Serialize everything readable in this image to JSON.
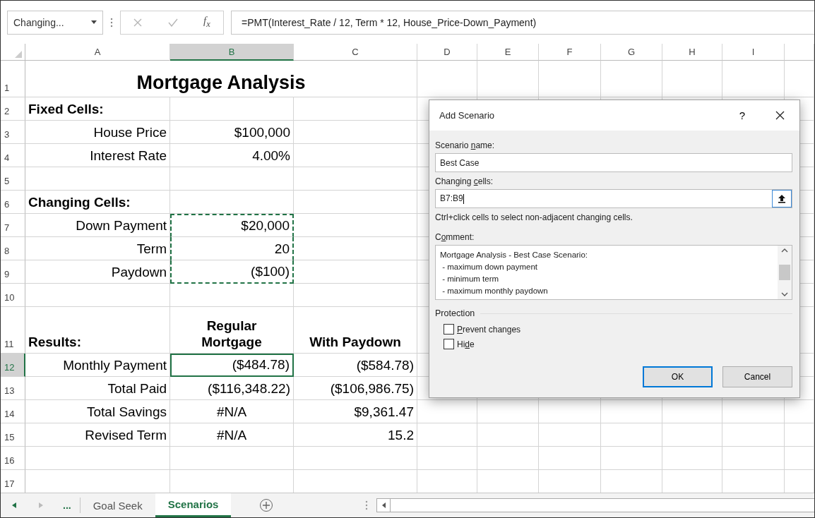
{
  "formula_bar": {
    "name_box": "Changing...",
    "fx_label": "f$_{x}$",
    "formula": "=PMT(Interest_Rate / 12, Term * 12, House_Price-Down_Payment)"
  },
  "columns": [
    {
      "label": "A",
      "selected": false
    },
    {
      "label": "B",
      "selected": true
    },
    {
      "label": "C",
      "selected": false
    },
    {
      "label": "D",
      "selected": false
    },
    {
      "label": "E",
      "selected": false
    },
    {
      "label": "F",
      "selected": false
    },
    {
      "label": "G",
      "selected": false
    },
    {
      "label": "H",
      "selected": false
    },
    {
      "label": "I",
      "selected": false
    }
  ],
  "rows": [
    {
      "number": "1",
      "selected": false,
      "title": "Mortgage Analysis"
    },
    {
      "number": "2",
      "selected": false,
      "cells": [
        {
          "text": "Fixed Cells:",
          "kind": "heading",
          "selected": false,
          "marked": false
        },
        null,
        null
      ]
    },
    {
      "number": "3",
      "selected": false,
      "cells": [
        {
          "text": "House Price",
          "kind": "label",
          "selected": false,
          "marked": false
        },
        {
          "text": "$100,000",
          "kind": "value",
          "selected": false,
          "marked": false
        },
        null
      ]
    },
    {
      "number": "4",
      "selected": false,
      "cells": [
        {
          "text": "Interest Rate",
          "kind": "label",
          "selected": false,
          "marked": false
        },
        {
          "text": "4.00%",
          "kind": "value",
          "selected": false,
          "marked": false
        },
        null
      ]
    },
    {
      "number": "5",
      "selected": false,
      "cells": [
        null,
        null,
        null
      ]
    },
    {
      "number": "6",
      "selected": false,
      "cells": [
        {
          "text": "Changing Cells:",
          "kind": "heading",
          "selected": false,
          "marked": false
        },
        null,
        null
      ]
    },
    {
      "number": "7",
      "selected": false,
      "cells": [
        {
          "text": "Down Payment",
          "kind": "label",
          "selected": false,
          "marked": false
        },
        {
          "text": "$20,000",
          "kind": "value",
          "selected": false,
          "marked": true
        },
        null
      ]
    },
    {
      "number": "8",
      "selected": false,
      "cells": [
        {
          "text": "Term",
          "kind": "label",
          "selected": false,
          "marked": false
        },
        {
          "text": "20",
          "kind": "value",
          "selected": false,
          "marked": true
        },
        null
      ]
    },
    {
      "number": "9",
      "selected": false,
      "cells": [
        {
          "text": "Paydown",
          "kind": "label",
          "selected": false,
          "marked": false
        },
        {
          "text": "($100)",
          "kind": "value",
          "selected": false,
          "marked": true
        },
        null
      ]
    },
    {
      "number": "10",
      "selected": false,
      "cells": [
        null,
        null,
        null
      ]
    },
    {
      "number": "11",
      "selected": false,
      "cells": [
        {
          "text": "Results:",
          "kind": "heading",
          "selected": false,
          "marked": false
        },
        {
          "lines": [
            "Regular",
            "Mortgage"
          ],
          "kind": "column-heading",
          "selected": false,
          "marked": false
        },
        {
          "lines": [
            "With Paydown"
          ],
          "kind": "column-heading",
          "selected": false,
          "marked": false
        }
      ]
    },
    {
      "number": "12",
      "selected": true,
      "cells": [
        {
          "text": "Monthly Payment",
          "kind": "label",
          "selected": false,
          "marked": false
        },
        {
          "text": "($484.78)",
          "kind": "value",
          "selected": true,
          "marked": false
        },
        {
          "text": "($584.78)",
          "kind": "value",
          "selected": false,
          "marked": false
        }
      ]
    },
    {
      "number": "13",
      "selected": false,
      "cells": [
        {
          "text": "Total Paid",
          "kind": "label",
          "selected": false,
          "marked": false
        },
        {
          "text": "($116,348.22)",
          "kind": "value",
          "selected": false,
          "marked": false
        },
        {
          "text": "($106,986.75)",
          "kind": "value",
          "selected": false,
          "marked": false
        }
      ]
    },
    {
      "number": "14",
      "selected": false,
      "cells": [
        {
          "text": "Total Savings",
          "kind": "label",
          "selected": false,
          "marked": false
        },
        {
          "text": "#N/A",
          "kind": "center",
          "selected": false,
          "marked": false
        },
        {
          "text": "$9,361.47",
          "kind": "value",
          "selected": false,
          "marked": false
        }
      ]
    },
    {
      "number": "15",
      "selected": false,
      "cells": [
        {
          "text": "Revised Term",
          "kind": "label",
          "selected": false,
          "marked": false
        },
        {
          "text": "#N/A",
          "kind": "center",
          "selected": false,
          "marked": false
        },
        {
          "text": "15.2",
          "kind": "value",
          "selected": false,
          "marked": false
        }
      ]
    },
    {
      "number": "16",
      "selected": false,
      "cells": [
        null,
        null,
        null
      ]
    },
    {
      "number": "17",
      "selected": false,
      "cells": [
        null,
        null,
        null
      ]
    }
  ],
  "dialog": {
    "title": "Add Scenario",
    "help": "?",
    "name_field": {
      "label_parts": {
        "before": "Scenario ",
        "key": "n",
        "after": "ame:"
      },
      "value": "Best Case",
      "focused": false
    },
    "cells_field": {
      "label_parts": {
        "before": "Changing ",
        "key": "c",
        "after": "ells:"
      },
      "value": "B7:B9",
      "focused": true
    },
    "hint": "Ctrl+click cells to select non-adjacent changing cells.",
    "comment": {
      "label_parts": {
        "before": "C",
        "key": "o",
        "after": "mment:"
      },
      "lines": [
        "Mortgage Analysis - Best Case Scenario:",
        " - maximum down payment",
        " - minimum term",
        " - maximum monthly paydown"
      ]
    },
    "protection": {
      "title": "Protection",
      "options": [
        {
          "label_parts": {
            "key": "P",
            "after": "revent changes"
          },
          "checked": false
        },
        {
          "label_parts": {
            "before": "Hi",
            "key": "d",
            "after": "e"
          },
          "checked": false
        }
      ]
    },
    "buttons": [
      {
        "label": "OK",
        "default": true
      },
      {
        "label": "Cancel",
        "default": false
      }
    ]
  },
  "sheet_tabs": {
    "more": "...",
    "tabs": [
      {
        "label": "Goal Seek",
        "selected": false
      },
      {
        "label": "Scenarios",
        "selected": true
      }
    ]
  }
}
